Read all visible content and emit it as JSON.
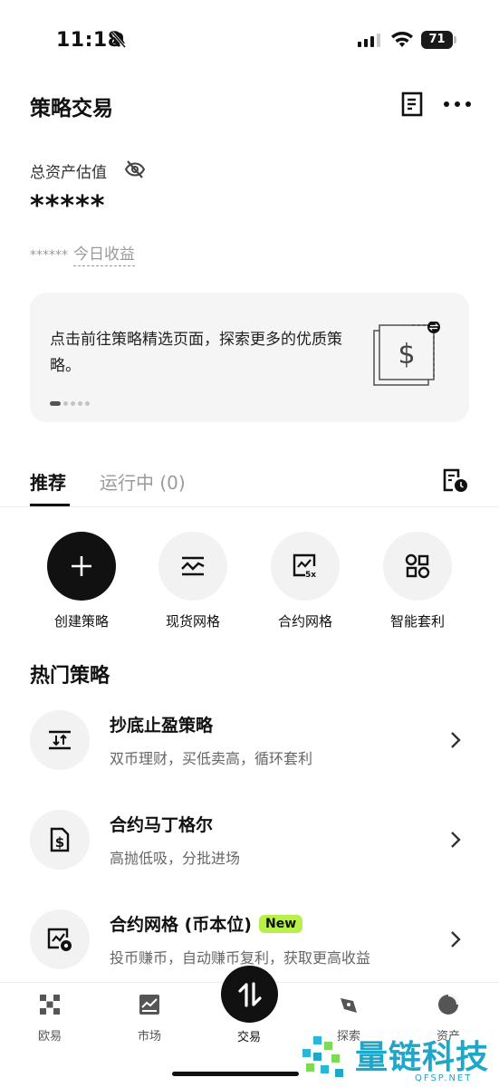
{
  "status_bar": {
    "time": "11:18",
    "battery": "71"
  },
  "header": {
    "title": "策略交易"
  },
  "assets": {
    "label": "总资产估值",
    "value": "*****",
    "profit_mask": "******",
    "profit_label": "今日收益"
  },
  "banner": {
    "text": "点击前往策略精选页面，探索更多的优质策略。",
    "page_index": 1,
    "page_count": 5
  },
  "tabs": [
    {
      "label": "推荐",
      "active": true
    },
    {
      "label": "运行中 (0)",
      "active": false
    }
  ],
  "quick_actions": [
    {
      "label": "创建策略",
      "icon": "plus-icon"
    },
    {
      "label": "现货网格",
      "icon": "spot-grid-icon"
    },
    {
      "label": "合约网格",
      "icon": "futures-grid-icon"
    },
    {
      "label": "智能套利",
      "icon": "arbitrage-icon"
    }
  ],
  "hot": {
    "title": "热门策略",
    "items": [
      {
        "title": "抄底止盈策略",
        "desc": "双币理财，买低卖高，循环套利",
        "icon": "buy-low-icon"
      },
      {
        "title": "合约马丁格尔",
        "desc": "高抛低吸，分批进场",
        "icon": "martingale-icon"
      },
      {
        "title": "合约网格 (币本位)",
        "badge": "New",
        "desc": "投币赚币，自动赚币复利，获取更高收益",
        "icon": "coin-grid-icon"
      }
    ]
  },
  "bottom_nav": {
    "items": [
      {
        "label": "欧易",
        "icon": "okx-logo-icon"
      },
      {
        "label": "市场",
        "icon": "market-chart-icon"
      },
      {
        "label": "交易",
        "icon": "trade-swap-icon"
      },
      {
        "label": "探索",
        "icon": "compass-icon"
      },
      {
        "label": "资产",
        "icon": "pie-chart-icon"
      }
    ]
  },
  "watermark": {
    "text": "量链科技",
    "sub": "QFSP.NET"
  },
  "colors": {
    "accent_badge": "#b8f04a",
    "watermark": "#1fa7c9",
    "primary": "#111111"
  }
}
